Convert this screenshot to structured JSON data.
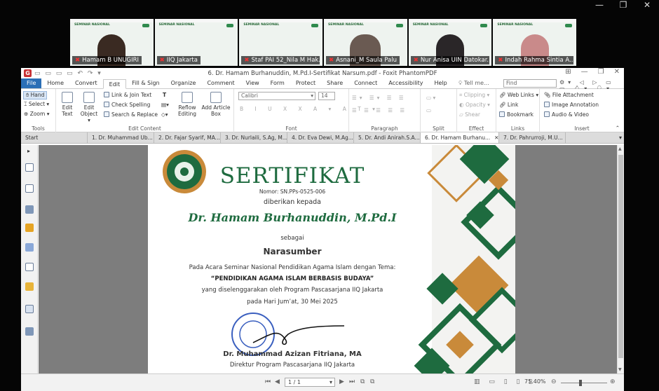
{
  "participants": [
    {
      "name": "Hamam B UNUGIRI",
      "banner": "SEMINAR NASIONAL"
    },
    {
      "name": "IIQ Jakarta",
      "banner": "SEMINAR NASIONAL"
    },
    {
      "name": "Staf PAI 52_Nila M Hak...",
      "banner": "SEMINAR NASIONAL"
    },
    {
      "name": "Asnani_M Saula Palu",
      "banner": "SEMINAR NASIONAL"
    },
    {
      "name": "Nur Anisa UIN Datokar...",
      "banner": "SEMINAR NASIONAL"
    },
    {
      "name": "Indah Rahma Sintia A...",
      "banner": "SEMINAR NASIONAL"
    }
  ],
  "app": {
    "title": "6. Dr. Hamam Burhanuddin, M.Pd.I-Sertifikat Narsum.pdf - Foxit PhantomPDF",
    "app_icon": "G",
    "menus": [
      "Home",
      "Convert",
      "Edit",
      "Fill & Sign",
      "Organize",
      "Comment",
      "View",
      "Form",
      "Protect",
      "Share",
      "Connect",
      "Accessibility",
      "Help"
    ],
    "file_menu": "File",
    "active_menu": "Edit",
    "tell_me": "Tell me...",
    "find_placeholder": "Find"
  },
  "ribbon": {
    "tools": {
      "hand": "Hand",
      "select": "Select",
      "zoom": "Zoom",
      "label": "Tools"
    },
    "edit_content": {
      "edit_text": "Edit Text",
      "edit_object": "Edit Object",
      "link_join": "Link & Join Text",
      "check_spelling": "Check Spelling",
      "search_replace": "Search & Replace",
      "reflow": "Reflow Editing",
      "add_article": "Add Article Box",
      "label": "Edit Content"
    },
    "font": {
      "family": "Calibri",
      "size": "14",
      "label": "Font"
    },
    "paragraph": {
      "label": "Paragraph"
    },
    "split": {
      "label": "Split"
    },
    "effect": {
      "clipping": "Clipping",
      "opacity": "Opacity",
      "shear": "Shear",
      "label": "Effect"
    },
    "links": {
      "web_links": "Web Links",
      "link": "Link",
      "bookmark": "Bookmark",
      "label": "Links"
    },
    "insert": {
      "file_attachment": "File Attachment",
      "image_annotation": "Image Annotation",
      "audio_video": "Audio & Video",
      "label": "Insert"
    }
  },
  "tabs": [
    "Start",
    "1. Dr. Muhammad Ub...",
    "2. Dr. Fajar Syarif, MA...",
    "3. Dr. Nurlaili, S.Ag, M...",
    "4. Dr. Eva Dewi, M.Ag...",
    "5. Dr. Andi Anirah.S.A...",
    "6. Dr. Hamam Burhanu...",
    "7. Dr. Pahrurroji, M.U..."
  ],
  "active_tab_index": 6,
  "certificate": {
    "title": "SERTIFIKAT",
    "number": "Nomor: SN.PPs-0525-006",
    "given_to": "diberikan kepada",
    "recipient": "Dr. Hamam Burhanuddin, M.Pd.I",
    "as": "sebagai",
    "role": "Narasumber",
    "event_line": "Pada Acara Seminar Nasional Pendidikan Agama Islam dengan Tema:",
    "theme": "“PENDIDIKAN AGAMA ISLAM BERBASIS BUDAYA”",
    "organizer": "yang diselenggarakan oleh Program Pascasarjana IIQ Jakarta",
    "date": "pada Hari Jum’at, 30 Mei 2025",
    "signer": "Dr. Muhammad Azizan Fitriana, MA",
    "signer_title": "Direktur Program Pascasarjana IIQ Jakarta"
  },
  "status": {
    "page": "1 / 1",
    "zoom": "75.40%"
  },
  "colors": {
    "accent_green": "#1e6b3f",
    "gold": "#c98a3a",
    "file_blue": "#2b6fb6"
  }
}
